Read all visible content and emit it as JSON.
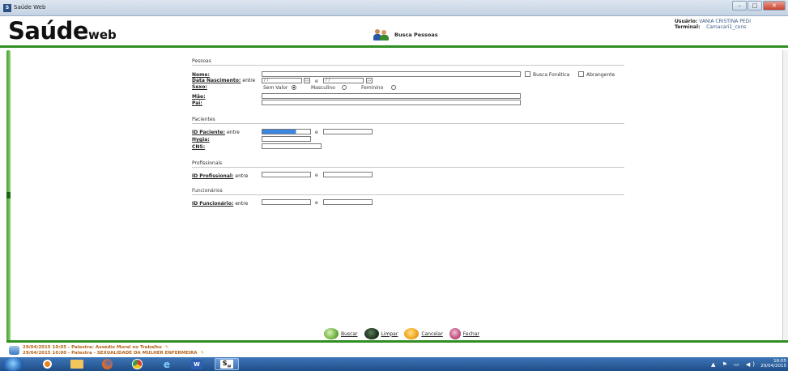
{
  "window": {
    "title": "Saúde Web"
  },
  "header": {
    "logo_big": "Saúde",
    "logo_small": "web",
    "page_title": "Busca Pessoas",
    "user_label": "Usuário:",
    "user_value": "VANIA CRISTINA PEDI",
    "terminal_label": "Terminal:",
    "terminal_value": "Camacari1_cons"
  },
  "form": {
    "pessoas": {
      "section_title": "Pessoas",
      "nome_label": "Nome:",
      "data_nasc_label": "Data Nascimento:",
      "data_nasc_between": "entre",
      "data_nasc_e": "e",
      "date_placeholder": "/ /",
      "busca_fonetica": "Busca Fonética",
      "abrangente": "Abrangente",
      "sexo_label": "Sexo:",
      "sexo_options": [
        "Sem Valor",
        "Masculino",
        "Feminino"
      ],
      "mae_label": "Mãe:",
      "pai_label": "Pai:"
    },
    "pacientes": {
      "section_title": "Pacientes",
      "id_label": "ID Paciente:",
      "id_between": "entre",
      "e": "e",
      "hygia_label": "Hygia:",
      "cns_label": "CNS:"
    },
    "profissionais": {
      "section_title": "Profissionais",
      "id_label": "ID Profissional:",
      "id_between": "entre",
      "e": "e"
    },
    "funcionarios": {
      "section_title": "Funcionários",
      "id_label": "ID Funcionário:",
      "id_between": "entre",
      "e": "e"
    }
  },
  "actions": {
    "buscar": "Buscar",
    "limpar": "Limpar",
    "cancelar": "Cancelar",
    "fechar": "Fechar"
  },
  "news": [
    "29/04/2015 10:05 - Palestra: Assédio Moral no Trabalho",
    "29/04/2015 10:00 - Palestra - SEXUALIDADE DA MULHER ENFERMEIRA"
  ],
  "taskbar": {
    "app_label": "S_W",
    "time": "16:05",
    "date": "29/04/2015"
  },
  "colors": {
    "brand_green": "#2f8f22",
    "news_text": "#b5621a",
    "taskbar": "#1f4d88"
  }
}
